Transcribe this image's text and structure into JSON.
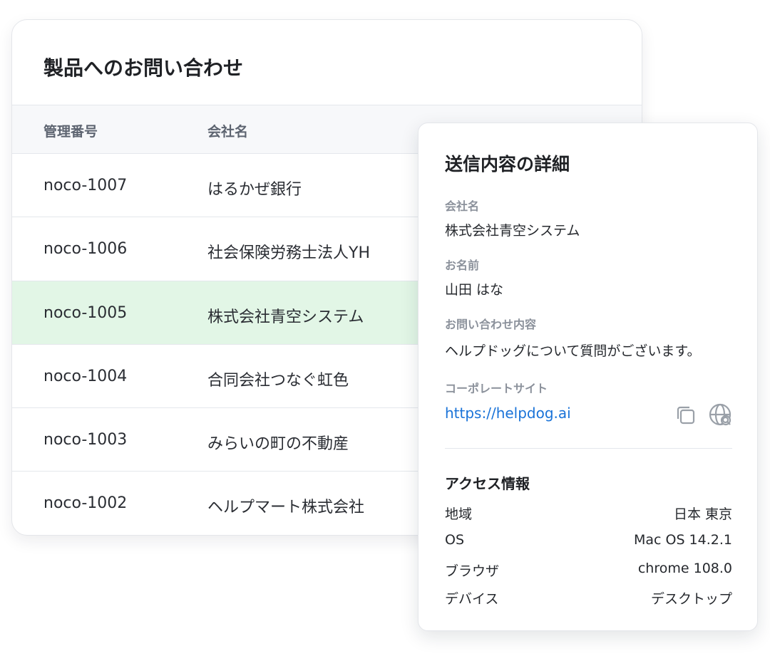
{
  "inquiries": {
    "title": "製品へのお問い合わせ",
    "columns": {
      "id": "管理番号",
      "company": "会社名"
    },
    "rows": [
      {
        "id": "noco-1007",
        "company": "はるかぜ銀行"
      },
      {
        "id": "noco-1006",
        "company": "社会保険労務士法人YH"
      },
      {
        "id": "noco-1005",
        "company": "株式会社青空システム",
        "selected": true
      },
      {
        "id": "noco-1004",
        "company": "合同会社つなぐ虹色"
      },
      {
        "id": "noco-1003",
        "company": "みらいの町の不動産"
      },
      {
        "id": "noco-1002",
        "company": "ヘルプマート株式会社"
      }
    ]
  },
  "detail": {
    "title": "送信内容の詳細",
    "company_label": "会社名",
    "company_value": "株式会社青空システム",
    "name_label": "お名前",
    "name_value": "山田 はな",
    "inquiry_label": "お問い合わせ内容",
    "inquiry_value": "ヘルプドッグについて質問がございます。",
    "site_label": "コーポレートサイト",
    "site_value": "https://helpdog.ai",
    "access_title": "アクセス情報",
    "access": [
      {
        "key": "地域",
        "value": "日本 東京"
      },
      {
        "key": "OS",
        "value": "Mac OS 14.2.1"
      },
      {
        "key": "ブラウザ",
        "value": "chrome 108.0"
      },
      {
        "key": "デバイス",
        "value": "デスクトップ"
      }
    ]
  },
  "icons": {
    "copy": "copy-icon",
    "open_site": "globe-search-icon"
  },
  "colors": {
    "selected_row": "#e2f6e6",
    "link": "#1a73d8",
    "header_bg": "#f7f8fa",
    "label": "#8b919b"
  }
}
